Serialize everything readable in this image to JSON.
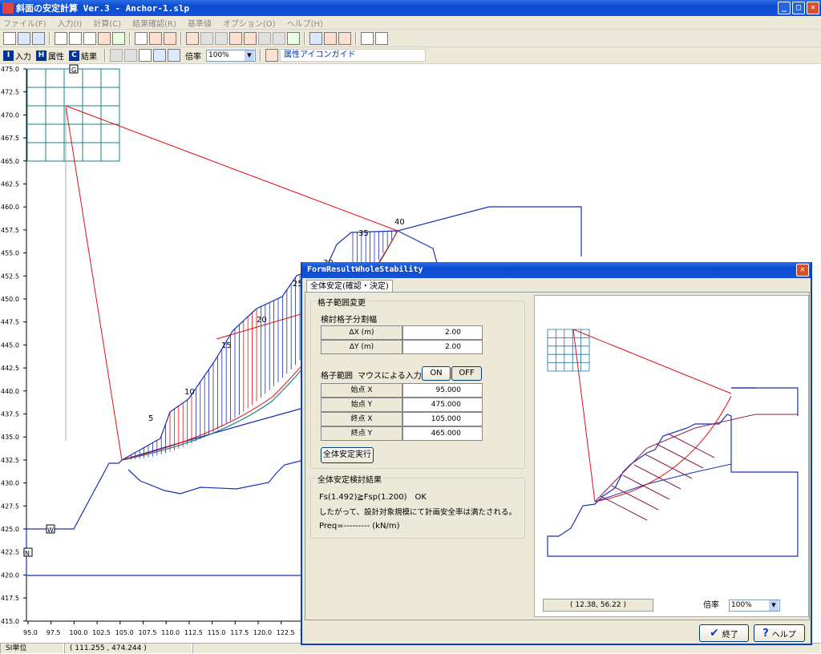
{
  "window": {
    "title": "斜面の安定計算 Ver.3 - Anchor-1.slp",
    "btn_min": "_",
    "btn_max": "□",
    "btn_close": "✕"
  },
  "menu": [
    "ファイル(F)",
    "入力(I)",
    "計算(C)",
    "結果確認(R)",
    "基準値",
    "オプション(O)",
    "ヘルプ(H)"
  ],
  "toolbar2": {
    "input": "入力",
    "attr": "属性",
    "result": "結果",
    "input_key": "I",
    "attr_key": "H",
    "result_key": "C",
    "zoom_label": "倍率",
    "zoom": "100%",
    "guide": "属性アイコンガイド"
  },
  "canvas": {
    "markers": [
      "G",
      "W",
      "N"
    ],
    "y_ticks": [
      "475.0",
      "472.5",
      "470.0",
      "467.5",
      "465.0",
      "462.5",
      "460.0",
      "457.5",
      "455.0",
      "452.5",
      "450.0",
      "447.5",
      "445.0",
      "442.5",
      "440.0",
      "437.5",
      "435.0",
      "432.5",
      "430.0",
      "427.5",
      "425.0",
      "422.5",
      "420.0",
      "417.5",
      "415.0"
    ],
    "x_ticks": [
      "95.0",
      "97.5",
      "100.0",
      "102.5",
      "105.0",
      "107.5",
      "110.0",
      "112.5",
      "115.0",
      "117.5",
      "120.0",
      "122.5",
      "12"
    ],
    "slice_labels": [
      "5",
      "10",
      "15",
      "20",
      "25",
      "30",
      "35",
      "40"
    ]
  },
  "status": {
    "unit": "SI単位",
    "coord": "( 111.255 , 474.244 )"
  },
  "dialog": {
    "title": "FormResultWholeStability",
    "tab": "全体安定(確認・決定)",
    "grid_group": "格子範囲変更",
    "split_label": "検討格子分割幅",
    "dx_label": "ΔX (m)",
    "dx": "2.00",
    "dy_label": "ΔY (m)",
    "dy": "2.00",
    "range_label": "格子範囲",
    "mouse_label": "マウスによる入力",
    "on": "ON",
    "off": "OFF",
    "sx_label": "始点 X",
    "sx": "95.000",
    "sy_label": "始点 Y",
    "sy": "475.000",
    "ex_label": "終点 X",
    "ex": "105.000",
    "ey_label": "終点 Y",
    "ey": "465.000",
    "run": "全体安定実行",
    "result_group": "全体安定検討結果",
    "fs_line": "Fs(1.492)≧Fsp(1.200)　OK",
    "conclusion": "したがって、設計対象規模にて計画安全率は満たされる。",
    "preq": "Preq=--------- (kN/m)",
    "preview_coord": "( 12.38, 56.22 )",
    "preview_zoom_label": "倍率",
    "preview_zoom": "100%",
    "ok": "終了",
    "help": "ヘルプ",
    "help_mark": "?",
    "ok_mark": "✔"
  },
  "colors": {
    "terrain": "#1a2fb8",
    "slip": "#e01010",
    "grid": "#1a8080",
    "title_blue": "#0b4bd1"
  }
}
